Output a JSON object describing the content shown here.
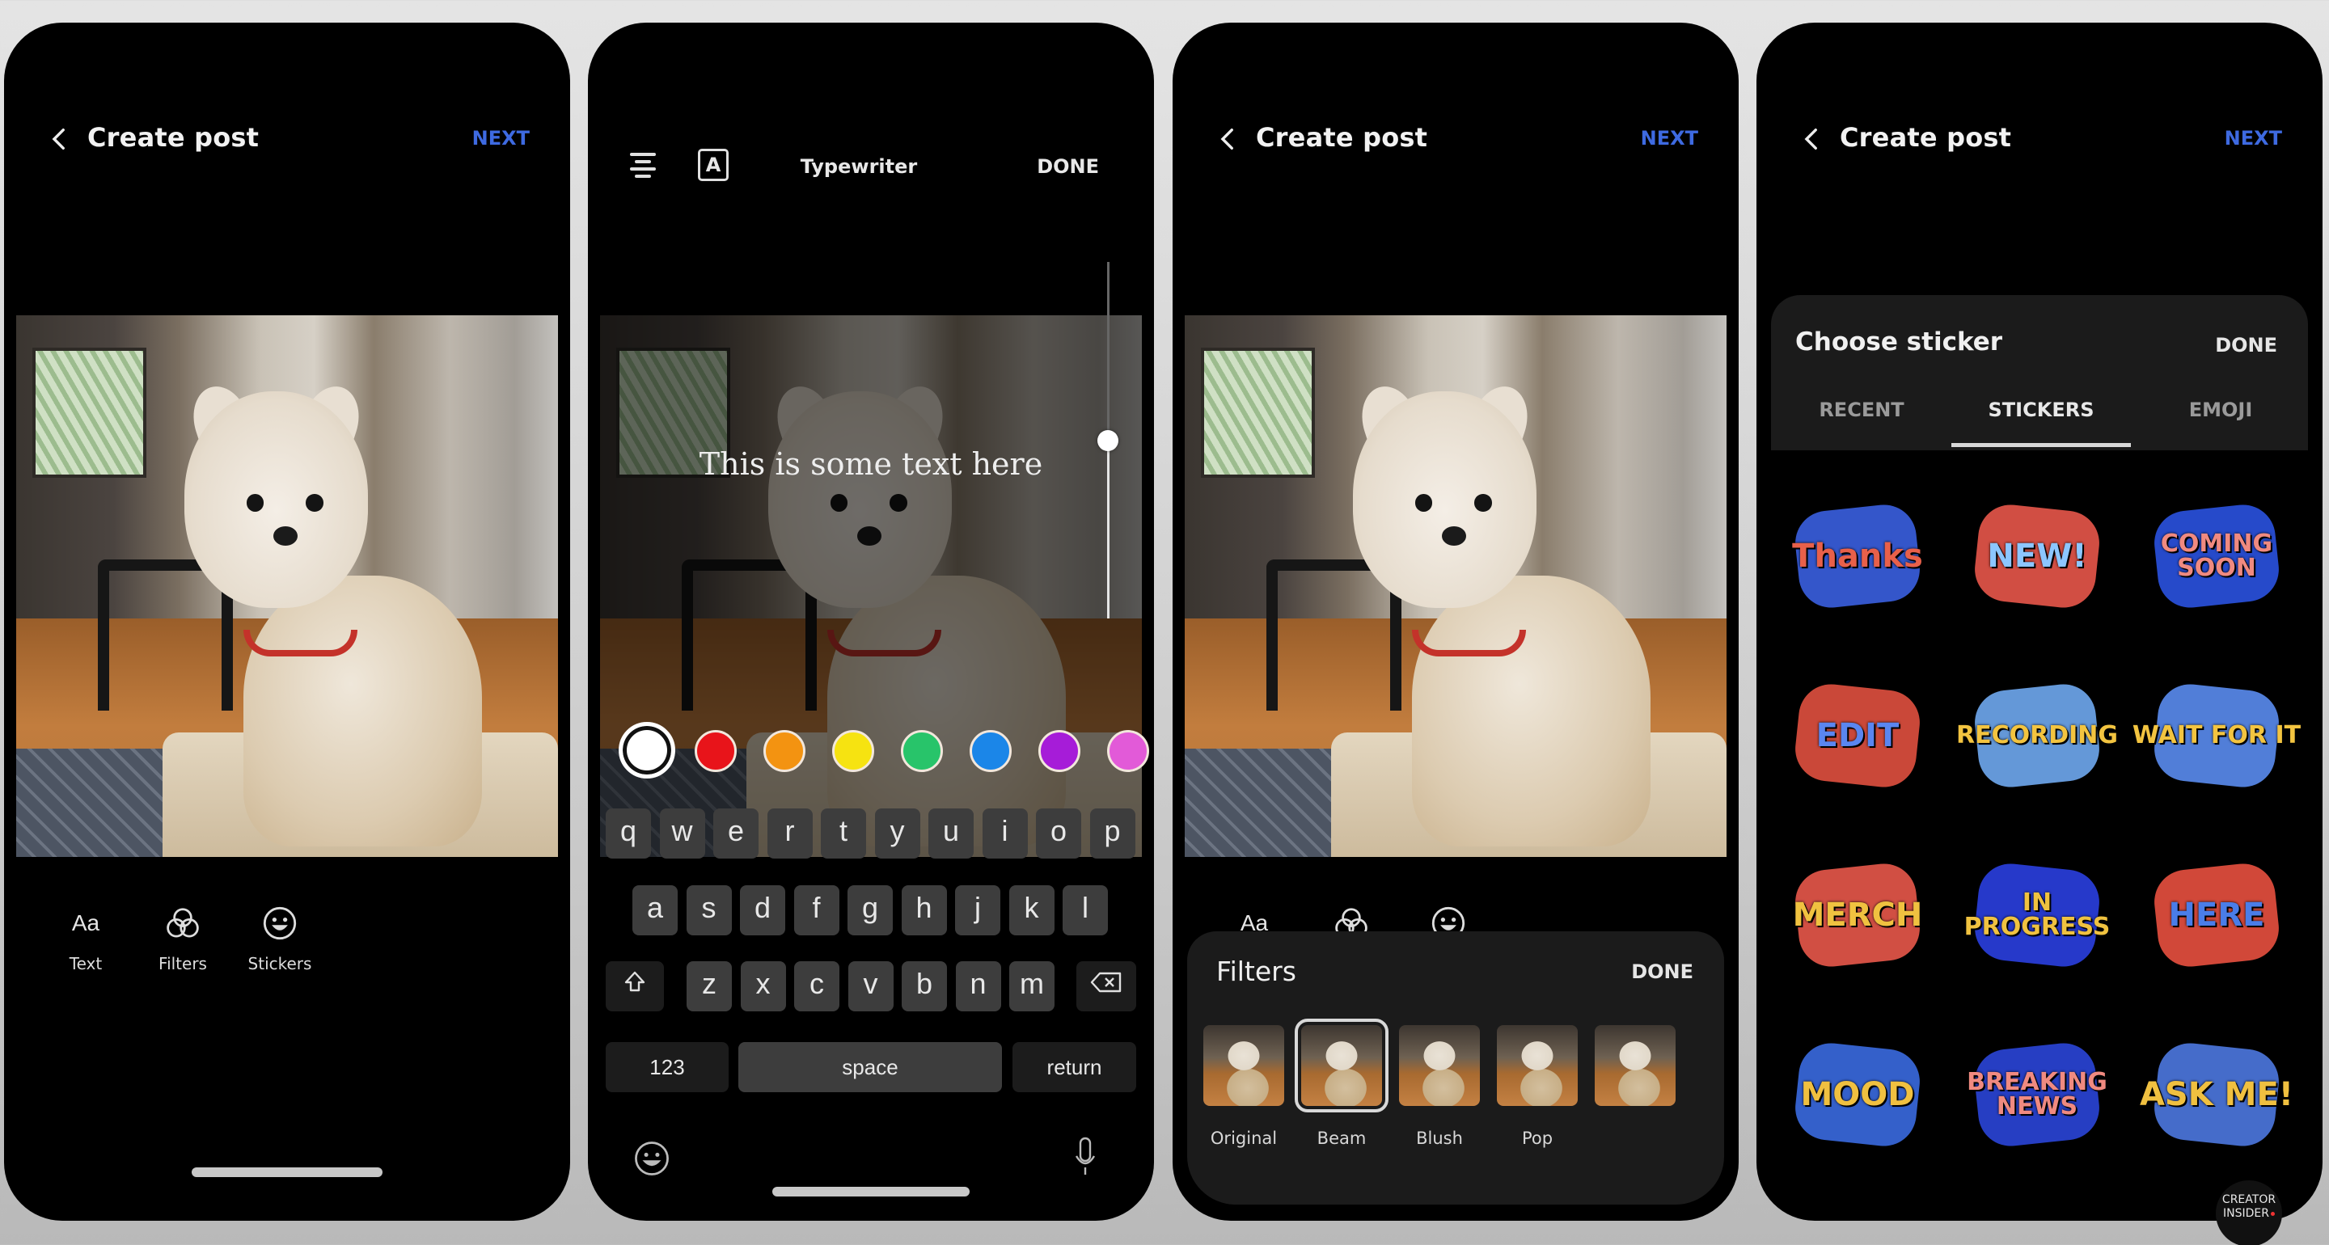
{
  "screens": {
    "compose": {
      "header": {
        "title": "Create post",
        "next_label": "NEXT"
      },
      "tools": [
        {
          "icon": "text-icon",
          "glyph": "Aa",
          "label": "Text"
        },
        {
          "icon": "filters-icon",
          "label": "Filters"
        },
        {
          "icon": "stickers-icon",
          "label": "Stickers"
        }
      ]
    },
    "text_editor": {
      "toolbar": {
        "align_icon": "align-center-icon",
        "font_icon_glyph": "A",
        "font_style": "Typewriter",
        "done_label": "DONE"
      },
      "overlay_text": "This is some text here",
      "size_slider_value": 0.5,
      "colors": [
        {
          "name": "white",
          "hex": "#ffffff",
          "selected": true
        },
        {
          "name": "red",
          "hex": "#e8141a",
          "selected": false
        },
        {
          "name": "orange",
          "hex": "#f39311",
          "selected": false
        },
        {
          "name": "yellow",
          "hex": "#f6e311",
          "selected": false
        },
        {
          "name": "green",
          "hex": "#28c46a",
          "selected": false
        },
        {
          "name": "blue",
          "hex": "#1b86e8",
          "selected": false
        },
        {
          "name": "purple",
          "hex": "#a61cd8",
          "selected": false
        },
        {
          "name": "pink",
          "hex": "#e25ad8",
          "selected": false
        }
      ],
      "keyboard": {
        "row1": [
          "q",
          "w",
          "e",
          "r",
          "t",
          "y",
          "u",
          "i",
          "o",
          "p"
        ],
        "row2": [
          "a",
          "s",
          "d",
          "f",
          "g",
          "h",
          "j",
          "k",
          "l"
        ],
        "row3": [
          "z",
          "x",
          "c",
          "v",
          "b",
          "n",
          "m"
        ],
        "shift_icon": "shift-icon",
        "backspace_icon": "backspace-icon",
        "numbers_label": "123",
        "space_label": "space",
        "return_label": "return",
        "emoji_icon": "emoji-icon",
        "mic_icon": "microphone-icon"
      }
    },
    "filters": {
      "header": {
        "title": "Create post",
        "next_label": "NEXT"
      },
      "sheet": {
        "title": "Filters",
        "done_label": "DONE",
        "options": [
          {
            "label": "Original",
            "selected": false
          },
          {
            "label": "Beam",
            "selected": true
          },
          {
            "label": "Blush",
            "selected": false
          },
          {
            "label": "Pop",
            "selected": false
          },
          {
            "label": "",
            "selected": false
          }
        ]
      }
    },
    "stickers": {
      "header": {
        "title": "Create post",
        "next_label": "NEXT"
      },
      "sheet": {
        "title": "Choose sticker",
        "done_label": "DONE",
        "tabs": [
          {
            "label": "RECENT",
            "active": false
          },
          {
            "label": "STICKERS",
            "active": true
          },
          {
            "label": "EMOJI",
            "active": false
          }
        ],
        "stickers": [
          {
            "text": "Thanks",
            "color": "#e8604a",
            "bg": "#3a5fe0"
          },
          {
            "text": "NEW!",
            "color": "#8cc6ff",
            "bg": "#e8574a"
          },
          {
            "text": "COMING SOON",
            "color": "#f08a80",
            "bg": "#2a52e0"
          },
          {
            "text": "EDIT",
            "color": "#5a86f0",
            "bg": "#e0503f"
          },
          {
            "text": "RECORDING",
            "color": "#f3c440",
            "bg": "#6fa8f0"
          },
          {
            "text": "WAIT FOR IT",
            "color": "#f3c440",
            "bg": "#5a8cf0"
          },
          {
            "text": "MERCH",
            "color": "#f0c240",
            "bg": "#e8584a"
          },
          {
            "text": "IN PROGRESS",
            "color": "#f0c240",
            "bg": "#2a3fe0"
          },
          {
            "text": "HERE",
            "color": "#4a7de8",
            "bg": "#e8503f"
          },
          {
            "text": "MOOD",
            "color": "#f0c040",
            "bg": "#3a6ae0"
          },
          {
            "text": "BREAKING NEWS",
            "color": "#f08a80",
            "bg": "#2a45d8"
          },
          {
            "text": "ASK ME!",
            "color": "#f0c040",
            "bg": "#4c78e0"
          }
        ]
      }
    }
  },
  "watermark": {
    "line1": "CREATOR",
    "line2": "INSIDER"
  },
  "colors": {
    "accent": "#3e6ae1",
    "sheet_bg": "#1b1b1b",
    "key_bg": "#3d3d3d"
  }
}
